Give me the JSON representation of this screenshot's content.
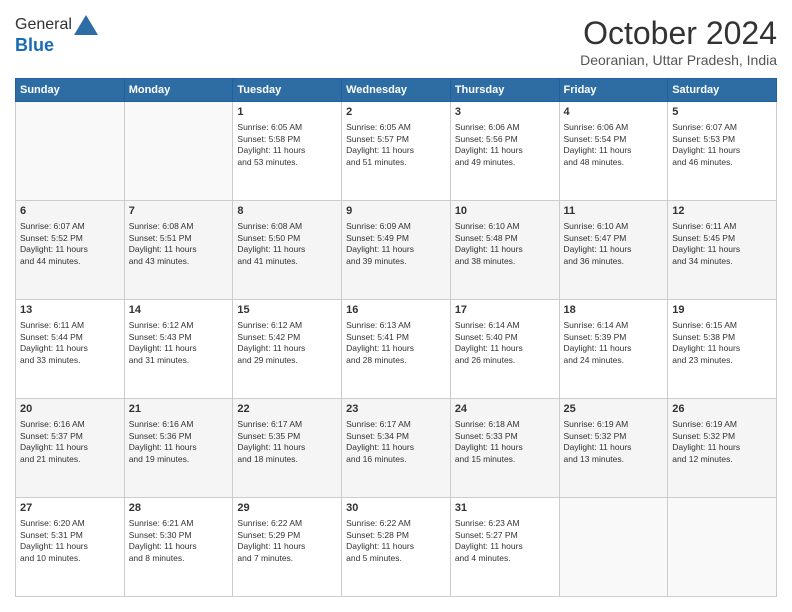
{
  "logo": {
    "general": "General",
    "blue": "Blue"
  },
  "title": "October 2024",
  "subtitle": "Deoranian, Uttar Pradesh, India",
  "weekdays": [
    "Sunday",
    "Monday",
    "Tuesday",
    "Wednesday",
    "Thursday",
    "Friday",
    "Saturday"
  ],
  "weeks": [
    [
      {
        "day": "",
        "empty": true
      },
      {
        "day": "",
        "empty": true
      },
      {
        "day": "1",
        "line1": "Sunrise: 6:05 AM",
        "line2": "Sunset: 5:58 PM",
        "line3": "Daylight: 11 hours",
        "line4": "and 53 minutes."
      },
      {
        "day": "2",
        "line1": "Sunrise: 6:05 AM",
        "line2": "Sunset: 5:57 PM",
        "line3": "Daylight: 11 hours",
        "line4": "and 51 minutes."
      },
      {
        "day": "3",
        "line1": "Sunrise: 6:06 AM",
        "line2": "Sunset: 5:56 PM",
        "line3": "Daylight: 11 hours",
        "line4": "and 49 minutes."
      },
      {
        "day": "4",
        "line1": "Sunrise: 6:06 AM",
        "line2": "Sunset: 5:54 PM",
        "line3": "Daylight: 11 hours",
        "line4": "and 48 minutes."
      },
      {
        "day": "5",
        "line1": "Sunrise: 6:07 AM",
        "line2": "Sunset: 5:53 PM",
        "line3": "Daylight: 11 hours",
        "line4": "and 46 minutes."
      }
    ],
    [
      {
        "day": "6",
        "line1": "Sunrise: 6:07 AM",
        "line2": "Sunset: 5:52 PM",
        "line3": "Daylight: 11 hours",
        "line4": "and 44 minutes."
      },
      {
        "day": "7",
        "line1": "Sunrise: 6:08 AM",
        "line2": "Sunset: 5:51 PM",
        "line3": "Daylight: 11 hours",
        "line4": "and 43 minutes."
      },
      {
        "day": "8",
        "line1": "Sunrise: 6:08 AM",
        "line2": "Sunset: 5:50 PM",
        "line3": "Daylight: 11 hours",
        "line4": "and 41 minutes."
      },
      {
        "day": "9",
        "line1": "Sunrise: 6:09 AM",
        "line2": "Sunset: 5:49 PM",
        "line3": "Daylight: 11 hours",
        "line4": "and 39 minutes."
      },
      {
        "day": "10",
        "line1": "Sunrise: 6:10 AM",
        "line2": "Sunset: 5:48 PM",
        "line3": "Daylight: 11 hours",
        "line4": "and 38 minutes."
      },
      {
        "day": "11",
        "line1": "Sunrise: 6:10 AM",
        "line2": "Sunset: 5:47 PM",
        "line3": "Daylight: 11 hours",
        "line4": "and 36 minutes."
      },
      {
        "day": "12",
        "line1": "Sunrise: 6:11 AM",
        "line2": "Sunset: 5:45 PM",
        "line3": "Daylight: 11 hours",
        "line4": "and 34 minutes."
      }
    ],
    [
      {
        "day": "13",
        "line1": "Sunrise: 6:11 AM",
        "line2": "Sunset: 5:44 PM",
        "line3": "Daylight: 11 hours",
        "line4": "and 33 minutes."
      },
      {
        "day": "14",
        "line1": "Sunrise: 6:12 AM",
        "line2": "Sunset: 5:43 PM",
        "line3": "Daylight: 11 hours",
        "line4": "and 31 minutes."
      },
      {
        "day": "15",
        "line1": "Sunrise: 6:12 AM",
        "line2": "Sunset: 5:42 PM",
        "line3": "Daylight: 11 hours",
        "line4": "and 29 minutes."
      },
      {
        "day": "16",
        "line1": "Sunrise: 6:13 AM",
        "line2": "Sunset: 5:41 PM",
        "line3": "Daylight: 11 hours",
        "line4": "and 28 minutes."
      },
      {
        "day": "17",
        "line1": "Sunrise: 6:14 AM",
        "line2": "Sunset: 5:40 PM",
        "line3": "Daylight: 11 hours",
        "line4": "and 26 minutes."
      },
      {
        "day": "18",
        "line1": "Sunrise: 6:14 AM",
        "line2": "Sunset: 5:39 PM",
        "line3": "Daylight: 11 hours",
        "line4": "and 24 minutes."
      },
      {
        "day": "19",
        "line1": "Sunrise: 6:15 AM",
        "line2": "Sunset: 5:38 PM",
        "line3": "Daylight: 11 hours",
        "line4": "and 23 minutes."
      }
    ],
    [
      {
        "day": "20",
        "line1": "Sunrise: 6:16 AM",
        "line2": "Sunset: 5:37 PM",
        "line3": "Daylight: 11 hours",
        "line4": "and 21 minutes."
      },
      {
        "day": "21",
        "line1": "Sunrise: 6:16 AM",
        "line2": "Sunset: 5:36 PM",
        "line3": "Daylight: 11 hours",
        "line4": "and 19 minutes."
      },
      {
        "day": "22",
        "line1": "Sunrise: 6:17 AM",
        "line2": "Sunset: 5:35 PM",
        "line3": "Daylight: 11 hours",
        "line4": "and 18 minutes."
      },
      {
        "day": "23",
        "line1": "Sunrise: 6:17 AM",
        "line2": "Sunset: 5:34 PM",
        "line3": "Daylight: 11 hours",
        "line4": "and 16 minutes."
      },
      {
        "day": "24",
        "line1": "Sunrise: 6:18 AM",
        "line2": "Sunset: 5:33 PM",
        "line3": "Daylight: 11 hours",
        "line4": "and 15 minutes."
      },
      {
        "day": "25",
        "line1": "Sunrise: 6:19 AM",
        "line2": "Sunset: 5:32 PM",
        "line3": "Daylight: 11 hours",
        "line4": "and 13 minutes."
      },
      {
        "day": "26",
        "line1": "Sunrise: 6:19 AM",
        "line2": "Sunset: 5:32 PM",
        "line3": "Daylight: 11 hours",
        "line4": "and 12 minutes."
      }
    ],
    [
      {
        "day": "27",
        "line1": "Sunrise: 6:20 AM",
        "line2": "Sunset: 5:31 PM",
        "line3": "Daylight: 11 hours",
        "line4": "and 10 minutes."
      },
      {
        "day": "28",
        "line1": "Sunrise: 6:21 AM",
        "line2": "Sunset: 5:30 PM",
        "line3": "Daylight: 11 hours",
        "line4": "and 8 minutes."
      },
      {
        "day": "29",
        "line1": "Sunrise: 6:22 AM",
        "line2": "Sunset: 5:29 PM",
        "line3": "Daylight: 11 hours",
        "line4": "and 7 minutes."
      },
      {
        "day": "30",
        "line1": "Sunrise: 6:22 AM",
        "line2": "Sunset: 5:28 PM",
        "line3": "Daylight: 11 hours",
        "line4": "and 5 minutes."
      },
      {
        "day": "31",
        "line1": "Sunrise: 6:23 AM",
        "line2": "Sunset: 5:27 PM",
        "line3": "Daylight: 11 hours",
        "line4": "and 4 minutes."
      },
      {
        "day": "",
        "empty": true
      },
      {
        "day": "",
        "empty": true
      }
    ]
  ]
}
